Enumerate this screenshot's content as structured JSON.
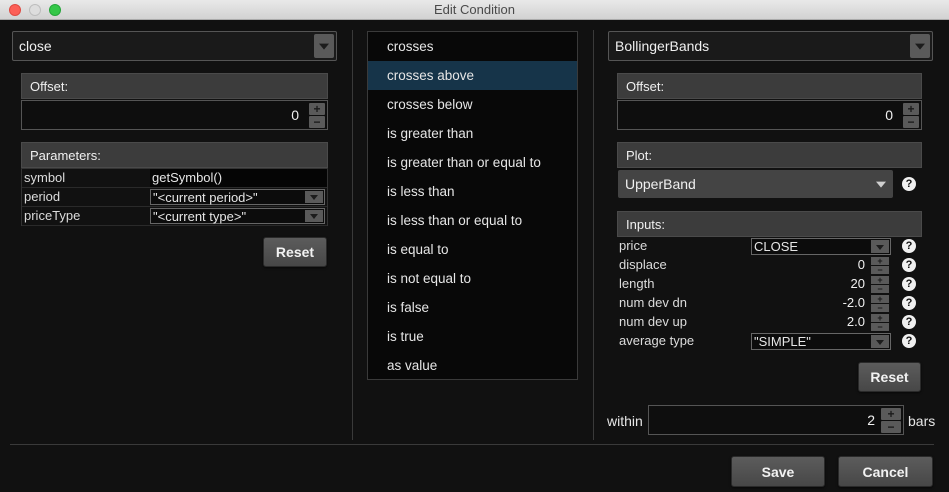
{
  "window": {
    "title": "Edit Condition"
  },
  "left": {
    "study_select": "close",
    "offset_header": "Offset:",
    "offset_value": "0",
    "params_header": "Parameters:",
    "params": [
      {
        "label": "symbol",
        "value": "getSymbol()",
        "kind": "text"
      },
      {
        "label": "period",
        "value": "\"<current period>\"",
        "kind": "select"
      },
      {
        "label": "priceType",
        "value": "\"<current type>\"",
        "kind": "select"
      }
    ],
    "reset_label": "Reset"
  },
  "operators": {
    "selected": "crosses above",
    "items": [
      "crosses",
      "crosses above",
      "crosses below",
      "is greater than",
      "is greater than or equal to",
      "is less than",
      "is less than or equal to",
      "is equal to",
      "is not equal to",
      "is false",
      "is true",
      "as value"
    ]
  },
  "right": {
    "study_select": "BollingerBands",
    "offset_header": "Offset:",
    "offset_value": "0",
    "plot_header": "Plot:",
    "plot_value": "UpperBand",
    "inputs_header": "Inputs:",
    "inputs": [
      {
        "label": "price",
        "value": "CLOSE",
        "kind": "select"
      },
      {
        "label": "displace",
        "value": "0",
        "kind": "number"
      },
      {
        "label": "length",
        "value": "20",
        "kind": "number"
      },
      {
        "label": "num dev dn",
        "value": "-2.0",
        "kind": "number"
      },
      {
        "label": "num dev up",
        "value": "2.0",
        "kind": "number"
      },
      {
        "label": "average type",
        "value": "\"SIMPLE\"",
        "kind": "select"
      }
    ],
    "reset_label": "Reset"
  },
  "within": {
    "label": "within",
    "value": "2",
    "unit": "bars"
  },
  "footer": {
    "save_label": "Save",
    "cancel_label": "Cancel"
  },
  "icons": {
    "help": "?",
    "plus": "+",
    "minus": "−"
  }
}
